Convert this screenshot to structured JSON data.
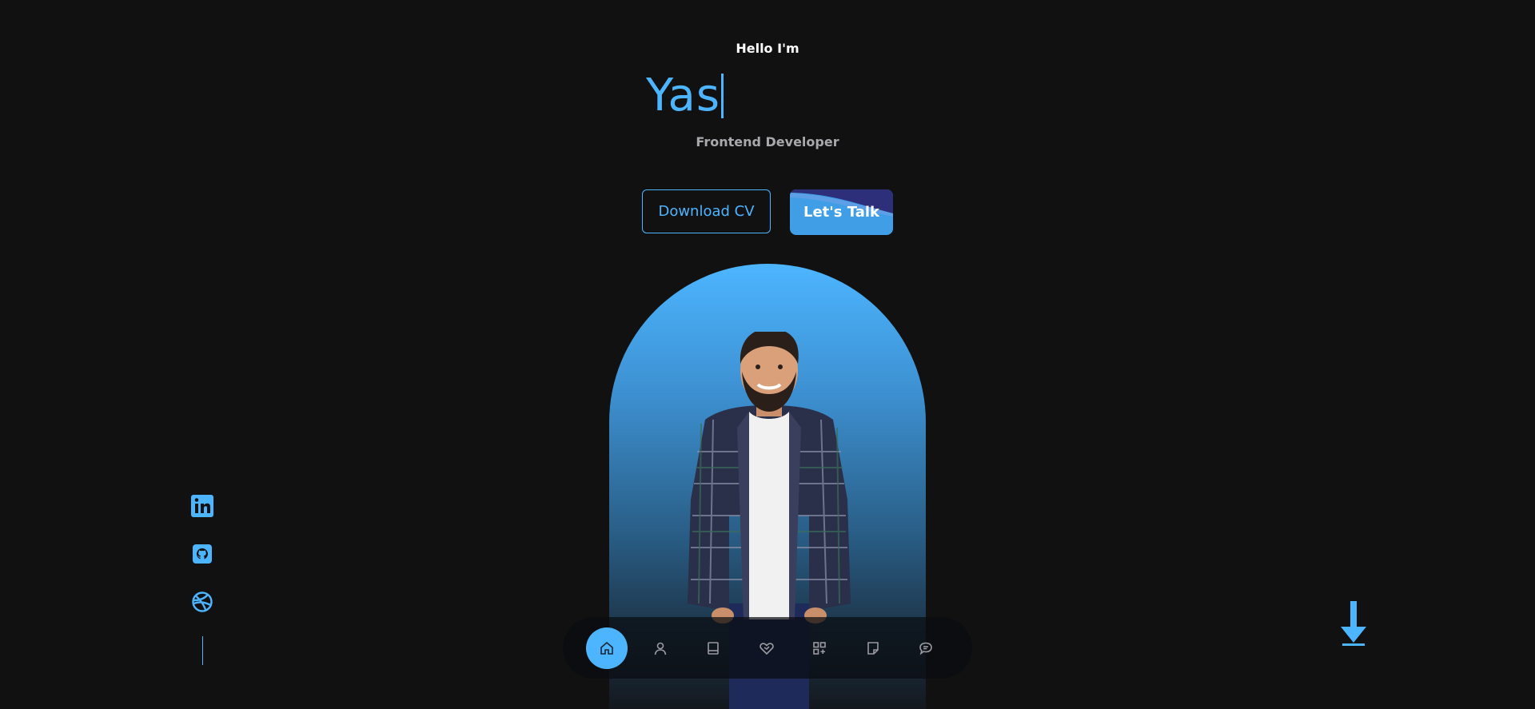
{
  "header": {
    "greeting": "Hello I'm",
    "name_typed": "Yas",
    "role": "Frontend Developer"
  },
  "cta": {
    "download_cv_label": "Download CV",
    "lets_talk_label": "Let's Talk"
  },
  "socials": [
    {
      "name": "linkedin",
      "icon": "linkedin-icon"
    },
    {
      "name": "github",
      "icon": "github-icon"
    },
    {
      "name": "dribbble",
      "icon": "dribbble-icon"
    }
  ],
  "nav": {
    "items": [
      {
        "icon": "home-icon",
        "active": true
      },
      {
        "icon": "user-icon",
        "active": false
      },
      {
        "icon": "book-icon",
        "active": false
      },
      {
        "icon": "handshake-icon",
        "active": false
      },
      {
        "icon": "grid-icon",
        "active": false
      },
      {
        "icon": "note-icon",
        "active": false
      },
      {
        "icon": "chat-icon",
        "active": false
      }
    ]
  },
  "colors": {
    "background": "#111112",
    "accent": "#4db5ff",
    "muted_text": "#a9a9ad",
    "nav_icon": "#9a9aa0"
  }
}
